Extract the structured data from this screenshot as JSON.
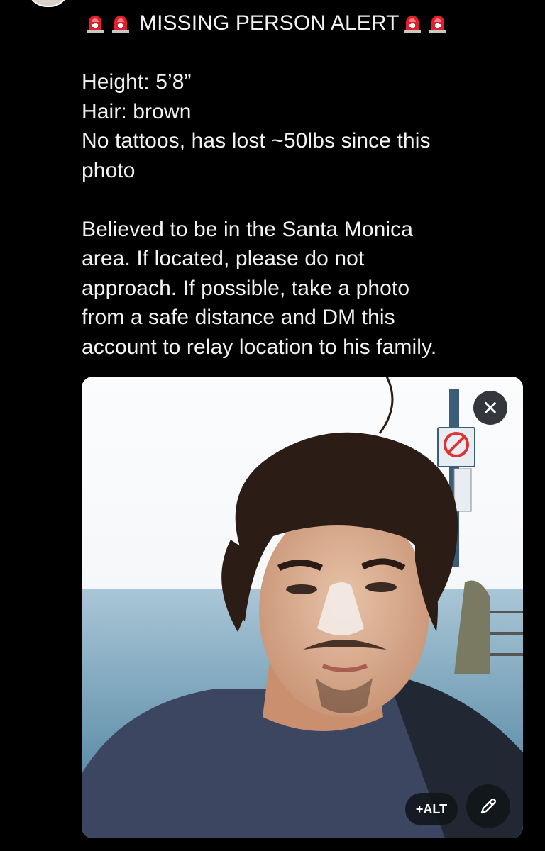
{
  "post": {
    "alert_title": "MISSING PERSON ALERT",
    "height": "Height: 5’8”",
    "hair": "Hair: brown",
    "tattoos_line1": "No tattoos, has lost ~50lbs since this",
    "tattoos_line2": "photo",
    "body_line1": "Believed to be in the Santa Monica",
    "body_line2": "area. If located, please do not",
    "body_line3": "approach. If possible, take a photo",
    "body_line4": "from a safe distance and DM this",
    "body_line5": "account to relay location to his family."
  },
  "media": {
    "alt_label": "+ALT",
    "close_glyph": "✕",
    "icons": [
      "siren-icon",
      "close-icon",
      "pencil-icon"
    ]
  },
  "colors": {
    "background": "#000000",
    "text": "#f2f2f2",
    "siren_red": "#e0202a",
    "overlay": "#0f1419"
  }
}
